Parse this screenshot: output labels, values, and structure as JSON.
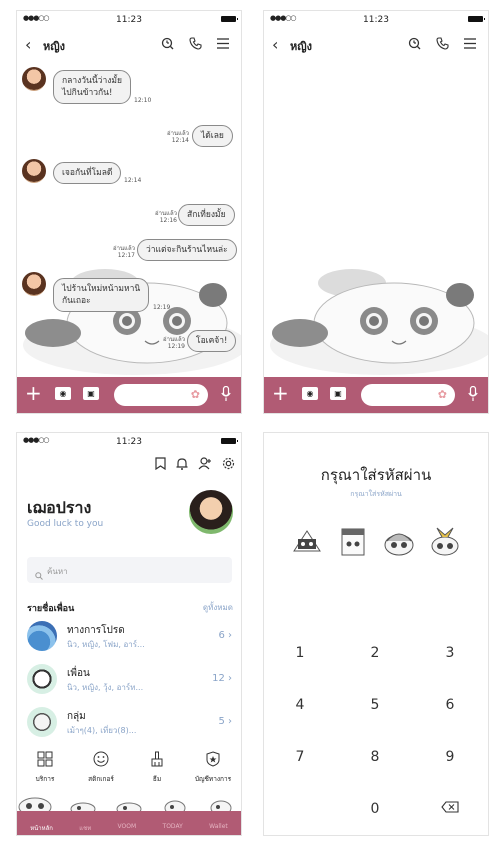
{
  "status": {
    "time": "11:23",
    "signal": "●●●○○"
  },
  "chat": {
    "contact_name": "หญิง",
    "messages": [
      {
        "side": "left",
        "lines": [
          "กลางวันนี้ว่างมั้ย",
          "ไปกินข้าวกัน!"
        ],
        "time": "12:10"
      },
      {
        "side": "right",
        "lines": [
          "ได้เลย"
        ],
        "read": "อ่านแล้ว",
        "time": "12:14"
      },
      {
        "side": "left",
        "lines": [
          "เจอกันที่โมลดี"
        ],
        "time": "12:14"
      },
      {
        "side": "right",
        "lines": [
          "สักเที่ยงมั้ย"
        ],
        "read": "อ่านแล้ว",
        "time": "12:16"
      },
      {
        "side": "right",
        "lines": [
          "ว่าแต่จะกินร้านไหนล่ะ"
        ],
        "read": "อ่านแล้ว",
        "time": "12:17"
      },
      {
        "side": "left",
        "lines": [
          "ไปร้านใหม่หน้ามหานิ",
          "กันเถอะ"
        ],
        "time": "12:19"
      },
      {
        "side": "right",
        "lines": [
          "โอเคจ้า!"
        ],
        "read": "อ่านแล้ว",
        "time": "12:19"
      }
    ]
  },
  "profile": {
    "name": "เฌอปราง",
    "status_message": "Good luck to you",
    "search_placeholder": "ค้นหา",
    "friends_heading": "รายชื่อเพื่อน",
    "see_all": "ดูทั้งหมด",
    "groups": [
      {
        "title": "ทางการโปรด",
        "subtitle": "นิว, หญิง, โฟม, อาร์...",
        "count": "6"
      },
      {
        "title": "เพื่อน",
        "subtitle": "นิว, หญิง, วุ้ง, อาร์ท...",
        "count": "12"
      },
      {
        "title": "กลุ่ม",
        "subtitle": "เม้าๆ(4), เที่ยว(8)...",
        "count": "5"
      }
    ],
    "services": [
      {
        "label": "บริการ",
        "icon": "grid-icon"
      },
      {
        "label": "สติกเกอร์",
        "icon": "smiley-icon"
      },
      {
        "label": "ธีม",
        "icon": "brush-icon"
      },
      {
        "label": "บัญชีทางการ",
        "icon": "badge-icon"
      }
    ],
    "tabs": [
      "หน้าหลัก",
      "แชท",
      "VOOM",
      "TODAY",
      "Wallet"
    ]
  },
  "passcode": {
    "title": "กรุณาใส่รหัสผ่าน",
    "subtitle": "กรุณาใส่รหัสผ่าน",
    "keys": [
      "1",
      "2",
      "3",
      "4",
      "5",
      "6",
      "7",
      "8",
      "9",
      "0"
    ]
  },
  "colors": {
    "accent": "#b15b74",
    "link": "#8aa4c8"
  }
}
